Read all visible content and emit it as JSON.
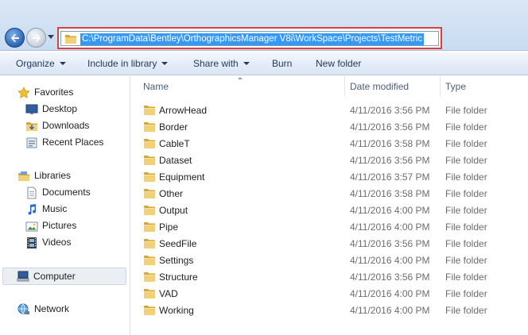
{
  "address": {
    "path": "C:\\ProgramData\\Bentley\\OrthographicsManager V8i\\WorkSpace\\Projects\\TestMetric"
  },
  "toolbar": {
    "organize": "Organize",
    "include_in_library": "Include in library",
    "share_with": "Share with",
    "burn": "Burn",
    "new_folder": "New folder"
  },
  "sidebar": {
    "favorites": "Favorites",
    "desktop": "Desktop",
    "downloads": "Downloads",
    "recent_places": "Recent Places",
    "libraries": "Libraries",
    "documents": "Documents",
    "music": "Music",
    "pictures": "Pictures",
    "videos": "Videos",
    "computer": "Computer",
    "network": "Network"
  },
  "columns": {
    "name": "Name",
    "date_modified": "Date modified",
    "type": "Type"
  },
  "files": [
    {
      "name": "ArrowHead",
      "date": "4/11/2016 3:56 PM",
      "type": "File folder"
    },
    {
      "name": "Border",
      "date": "4/11/2016 3:56 PM",
      "type": "File folder"
    },
    {
      "name": "CableT",
      "date": "4/11/2016 3:58 PM",
      "type": "File folder"
    },
    {
      "name": "Dataset",
      "date": "4/11/2016 3:56 PM",
      "type": "File folder"
    },
    {
      "name": "Equipment",
      "date": "4/11/2016 3:57 PM",
      "type": "File folder"
    },
    {
      "name": "Other",
      "date": "4/11/2016 3:58 PM",
      "type": "File folder"
    },
    {
      "name": "Output",
      "date": "4/11/2016 4:00 PM",
      "type": "File folder"
    },
    {
      "name": "Pipe",
      "date": "4/11/2016 4:00 PM",
      "type": "File folder"
    },
    {
      "name": "SeedFile",
      "date": "4/11/2016 3:56 PM",
      "type": "File folder"
    },
    {
      "name": "Settings",
      "date": "4/11/2016 4:00 PM",
      "type": "File folder"
    },
    {
      "name": "Structure",
      "date": "4/11/2016 3:56 PM",
      "type": "File folder"
    },
    {
      "name": "VAD",
      "date": "4/11/2016 4:00 PM",
      "type": "File folder"
    },
    {
      "name": "Working",
      "date": "4/11/2016 4:00 PM",
      "type": "File folder"
    }
  ],
  "colors": {
    "address_highlight": "#d9413b",
    "selection": "#3399ff",
    "folder": "#e8c25a"
  }
}
